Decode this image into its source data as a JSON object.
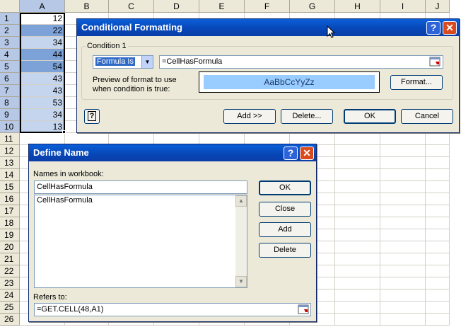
{
  "columns": [
    "A",
    "B",
    "C",
    "D",
    "E",
    "F",
    "G",
    "H",
    "I",
    "J"
  ],
  "rows": [
    "1",
    "2",
    "3",
    "4",
    "5",
    "6",
    "7",
    "8",
    "9",
    "10",
    "11",
    "12",
    "13",
    "14",
    "15",
    "16",
    "17",
    "18",
    "19",
    "20",
    "21",
    "22",
    "23",
    "24",
    "25",
    "26"
  ],
  "colA_values": [
    "12",
    "22",
    "34",
    "44",
    "54",
    "43",
    "43",
    "53",
    "34",
    "13"
  ],
  "cf_dialog": {
    "title": "Conditional Formatting",
    "condition_label": "Condition 1",
    "mode": "Formula Is",
    "formula": "=CellHasFormula",
    "preview_label_1": "Preview of format to use",
    "preview_label_2": "when condition is true:",
    "preview_text": "AaBbCcYyZz",
    "format_button": "Format...",
    "add_button": "Add >>",
    "delete_button": "Delete...",
    "ok_button": "OK",
    "cancel_button": "Cancel",
    "help_glyph": "?",
    "close_glyph": "✕"
  },
  "dn_dialog": {
    "title": "Define Name",
    "names_label": "Names in workbook:",
    "name_value": "CellHasFormula",
    "list_items": [
      "CellHasFormula"
    ],
    "refers_label": "Refers to:",
    "refers_value": "=GET.CELL(48,A1)",
    "ok_button": "OK",
    "close_button": "Close",
    "add_button": "Add",
    "delete_button": "Delete",
    "help_glyph": "?",
    "close_glyph": "✕"
  },
  "colors": {
    "selection_blue": "#b6c8e6",
    "cf_dark": "#7da2d8",
    "cf_light": "#c5d5ee",
    "preview_fill": "#99ccff",
    "titlebar": "#0846b6"
  }
}
